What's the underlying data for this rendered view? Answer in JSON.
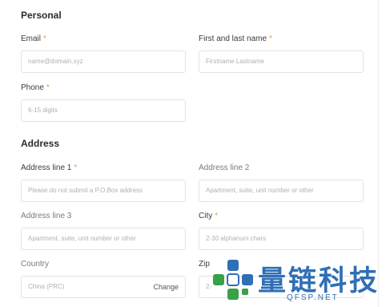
{
  "personal": {
    "title": "Personal",
    "email": {
      "label": "Email",
      "placeholder": "name@domain.xyz"
    },
    "name": {
      "label": "First and last name",
      "placeholder": "Firstname Lastname"
    },
    "phone": {
      "label": "Phone",
      "placeholder": "6-15 digits"
    }
  },
  "address": {
    "title": "Address",
    "line1": {
      "label": "Address line 1",
      "placeholder": "Please do not submit a P.O.Box address"
    },
    "line2": {
      "label": "Address line 2",
      "placeholder": "Apartment, suite, unit number or other"
    },
    "line3": {
      "label": "Address line 3",
      "placeholder": "Apartment, suite, unit number or other"
    },
    "city": {
      "label": "City",
      "placeholder": "2-30 alphanum chars"
    },
    "country": {
      "label": "Country",
      "value": "China (PRC)",
      "change_label": "Change"
    },
    "zip": {
      "label": "Zip",
      "placeholder": "2-"
    }
  },
  "required_mark": "*",
  "watermark": {
    "text": "量链科技",
    "sub": "QFSP.NET"
  },
  "colors": {
    "accent": "#f29a38",
    "watermark": "#2f6fb5",
    "border": "#e2e2e2"
  }
}
